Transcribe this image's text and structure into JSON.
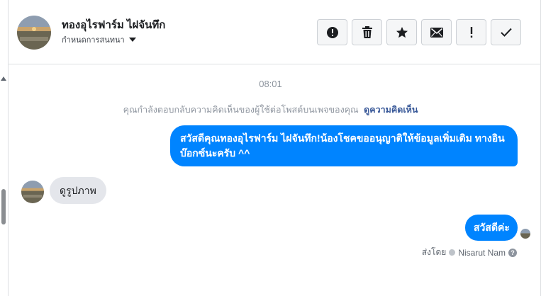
{
  "contact": {
    "name": "ทองอุไรฟาร์ม ไฝจันทึก",
    "subtitle": "กำหนดการสนทนา"
  },
  "toolbar": {
    "items": [
      {
        "icon": "alert-circle-icon",
        "action": "mark-spam"
      },
      {
        "icon": "trash-icon",
        "action": "delete"
      },
      {
        "icon": "star-icon",
        "action": "star"
      },
      {
        "icon": "envelope-icon",
        "action": "mark-unread"
      },
      {
        "icon": "exclamation-icon",
        "action": "flag"
      },
      {
        "icon": "check-icon",
        "action": "done"
      }
    ]
  },
  "conversation": {
    "timestamp": "08:01",
    "notice_text": "คุณกำลังตอบกลับความคิดเห็นของผู้ใช้ต่อโพสต์บนเพจของคุณ",
    "notice_link": "ดูความคิดเห็น",
    "messages": [
      {
        "direction": "outgoing",
        "text": "สวัสดีคุณทองอุไรฟาร์ม ไฝจันทึก!น้องโชคขออนุญาติให้ข้อมูลเพิ่มเติม ทางอินบ๊อกซ์นะครับ ^^"
      },
      {
        "direction": "incoming",
        "text": "ดูรูปภาพ"
      },
      {
        "direction": "outgoing",
        "text": "สวัสดีค่ะ"
      }
    ],
    "sent_by_label": "ส่งโดย",
    "sent_by_name": "Nisarut Nam"
  },
  "colors": {
    "accent": "#0084ff",
    "incoming_bubble": "#e4e6eb",
    "link": "#385898"
  }
}
